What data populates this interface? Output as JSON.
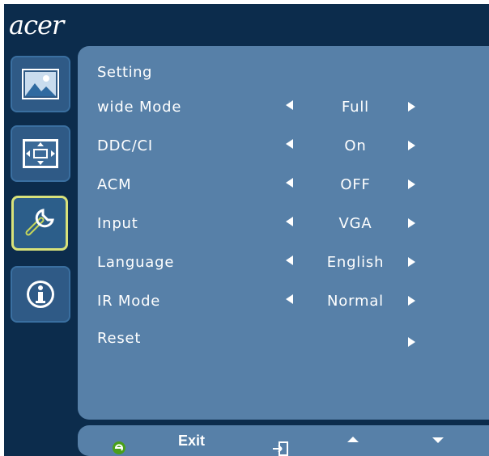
{
  "brand": {
    "logo": "acer"
  },
  "sidebar": {
    "items": [
      {
        "icon": "picture-icon"
      },
      {
        "icon": "position-icon"
      },
      {
        "icon": "setting-wrench-icon",
        "selected": true
      },
      {
        "icon": "information-icon"
      }
    ]
  },
  "panel": {
    "title": "Setting",
    "rows": [
      {
        "label": "wide Mode",
        "value": "Full"
      },
      {
        "label": "DDC/CI",
        "value": "On"
      },
      {
        "label": "ACM",
        "value": "OFF"
      },
      {
        "label": "Input",
        "value": "VGA"
      },
      {
        "label": "Language",
        "value": "English"
      },
      {
        "label": "IR Mode",
        "value": "Normal"
      },
      {
        "label": "Reset",
        "value": ""
      }
    ]
  },
  "footer": {
    "exit_label": "Exit"
  },
  "colors": {
    "background": "#0c2c4c",
    "panel": "#5780a8",
    "selected_border": "#d8e27a",
    "text": "#ffffff"
  }
}
